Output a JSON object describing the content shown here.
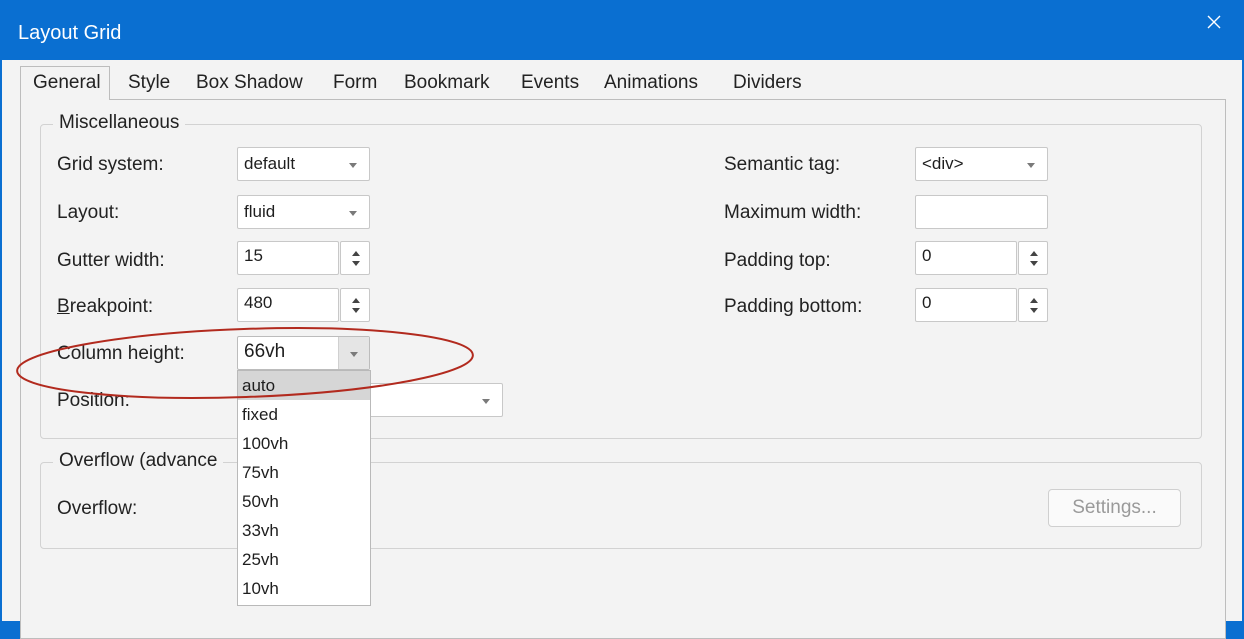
{
  "window": {
    "title": "Layout Grid"
  },
  "tabs": [
    "General",
    "Style",
    "Box Shadow",
    "Form",
    "Bookmark",
    "Events",
    "Animations",
    "Dividers"
  ],
  "miscellaneous": {
    "title": "Miscellaneous",
    "grid_system": {
      "label": "Grid system:",
      "value": "default"
    },
    "layout": {
      "label": "Layout:",
      "value": "fluid"
    },
    "gutter_width": {
      "label": "Gutter width:",
      "value": "15"
    },
    "breakpoint": {
      "label_underlined": "B",
      "label_rest": "reakpoint:",
      "value": "480"
    },
    "column_height": {
      "label": "Column height:",
      "value": "66vh"
    },
    "position": {
      "label": "Position:"
    },
    "semantic_tag": {
      "label": "Semantic tag:",
      "value": "<div>"
    },
    "maximum_width": {
      "label": "Maximum width:",
      "value": ""
    },
    "padding_top": {
      "label": "Padding top:",
      "value": "0"
    },
    "padding_bottom": {
      "label": "Padding bottom:",
      "value": "0"
    }
  },
  "overflow": {
    "title": "Overflow (advance",
    "label": "Overflow:",
    "settings_button": "Settings..."
  },
  "column_height_options": [
    "auto",
    "fixed",
    "100vh",
    "75vh",
    "50vh",
    "33vh",
    "25vh",
    "10vh"
  ],
  "colors": {
    "titlebar": "#0a6fd1",
    "annotation": "#b22a1e"
  }
}
